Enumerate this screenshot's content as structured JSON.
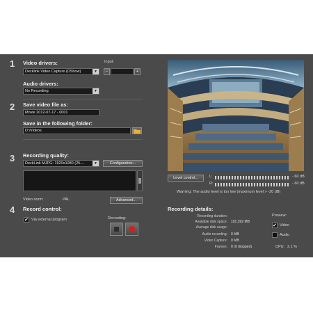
{
  "steps": [
    "1",
    "2",
    "3",
    "4"
  ],
  "video_drivers": {
    "heading": "Video drivers:",
    "value": "Decklink Video Capture (DShow)",
    "input_label": "Input:",
    "minus": "−",
    "plus": "+"
  },
  "audio_drivers": {
    "heading": "Audio drivers:",
    "value": "No Recording"
  },
  "save_file": {
    "heading": "Save video file as:",
    "value": "Movie 2012-07-17 - 0001"
  },
  "save_folder": {
    "heading": "Save in the following folder:",
    "value": "D:\\Videos",
    "folder_icon": "folder-icon"
  },
  "quality": {
    "heading": "Recording quality:",
    "value": "DeckLink MJPG: 1920x1080 (25....",
    "config_button": "Configuration...",
    "video_norm_label": "Video norm:",
    "video_norm_value": "PAL",
    "advanced_button": "Advanced..."
  },
  "record_control": {
    "heading": "Record control:",
    "external_label": "Via external program",
    "external_checked": true,
    "recording_label": "Recording:",
    "stop_icon": "stop-icon",
    "record_icon": "record-icon"
  },
  "preview": {
    "image_icon": "concert-hall-preview-image"
  },
  "level": {
    "button": "Level control...",
    "l_label": "L:",
    "r_label": "R:",
    "l_db": "- 60 dB",
    "r_db": "- 60 dB",
    "warning": "Warning: The audio level is too low (maximum level > -20 dB)"
  },
  "details": {
    "heading": "Recording details:",
    "rows": [
      {
        "label": "Recording duration:",
        "value": ""
      },
      {
        "label": "Available disk space:",
        "value": "101.392 MB"
      },
      {
        "label": "Average disk usage:",
        "value": ""
      },
      {
        "label": "Audio recording:",
        "value": "0 MB"
      },
      {
        "label": "Video Capture:",
        "value": "0 MB"
      },
      {
        "label": "Frames:",
        "value": "0 (0 dropped)"
      }
    ],
    "preview_label": "Preview:",
    "video_label": "Video",
    "video_checked": true,
    "audio_label": "Audio",
    "audio_checked": false,
    "cpu_label": "CPU:",
    "cpu_value": "2.1 %"
  },
  "colors": {
    "panel": "#4a4a4a",
    "record_red": "#d81c1c",
    "warning_text": "#d8d8d8"
  }
}
